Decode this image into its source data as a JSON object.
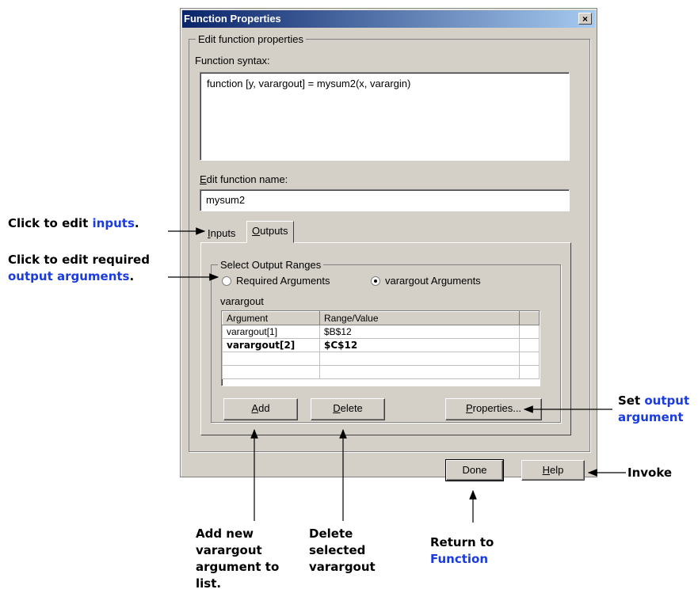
{
  "dialog": {
    "title": "Function Properties",
    "close_glyph": "×",
    "edit_group_label": "Edit function properties",
    "syntax_label": "Function syntax:",
    "syntax_text": "function [y, varargout] = mysum2(x, varargin)",
    "name_label": "Edit function name:",
    "name_value": "mysum2",
    "tabs": [
      {
        "label": "Inputs"
      },
      {
        "label": "Outputs"
      }
    ],
    "output_group_label": "Select Output Ranges",
    "radio_required": "Required Arguments",
    "radio_varargout": "varargout Arguments",
    "selected_radio": "varargout Arguments",
    "grid_label": "varargout",
    "columns": [
      "Argument",
      "Range/Value"
    ],
    "rows": [
      {
        "argument": "varargout[1]",
        "range": "$B$12"
      },
      {
        "argument": "varargout[2]",
        "range": "$C$12"
      }
    ],
    "buttons": {
      "add": "Add",
      "delete": "Delete",
      "properties": "Properties...",
      "done": "Done",
      "help": "Help"
    }
  },
  "annotations": {
    "inputs_prefix": "Click to edit ",
    "inputs_link": "inputs",
    "inputs_suffix": ".",
    "required_line1": "Click to edit required",
    "required_link": "output arguments",
    "required_suffix": ".",
    "set_prefix": "Set ",
    "set_link1": "output",
    "set_link2": "argument",
    "invoke": "Invoke",
    "add_lines": [
      "Add new",
      "varargout",
      "argument to",
      "list."
    ],
    "delete_lines": [
      "Delete",
      "selected",
      "varargout"
    ],
    "return_line1": "Return to",
    "return_link": "Function"
  },
  "colors": {
    "annotation_link": "#1a3be0",
    "titlebar_start": "#0a246a",
    "titlebar_end": "#a6caf0",
    "dialog_bg": "#d4d0c8"
  }
}
